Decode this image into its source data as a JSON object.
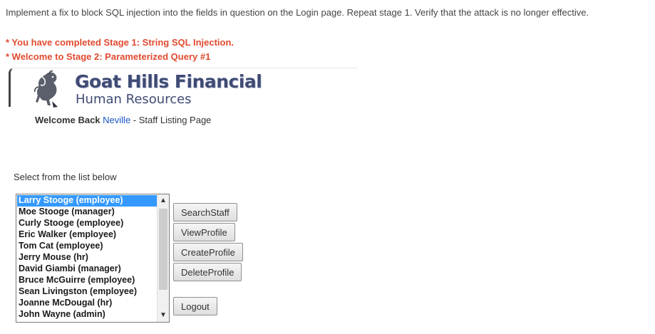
{
  "instructions": "Implement a fix to block SQL injection into the fields in question on the Login page. Repeat stage 1. Verify that the attack is no longer effective.",
  "messages": {
    "stage1": "* You have completed Stage 1: String SQL Injection.",
    "stage2": "* Welcome to Stage 2: Parameterized Query #1"
  },
  "banner": {
    "logo_icon": "goat-icon",
    "title": "Goat Hills Financial",
    "subtitle": "Human Resources"
  },
  "welcome": {
    "prefix": "Welcome Back",
    "user": "Neville",
    "suffix": "- Staff Listing Page"
  },
  "select_label": "Select from the list below",
  "staff_list": {
    "selected_index": 0,
    "items": [
      "Larry Stooge (employee)",
      "Moe Stooge (manager)",
      "Curly Stooge (employee)",
      "Eric Walker (employee)",
      "Tom Cat (employee)",
      "Jerry Mouse (hr)",
      "David Giambi (manager)",
      "Bruce McGuirre (employee)",
      "Sean Livingston (employee)",
      "Joanne McDougal (hr)",
      "John Wayne (admin)"
    ]
  },
  "buttons": {
    "search": "SearchStaff",
    "view": "ViewProfile",
    "create": "CreateProfile",
    "delete": "DeleteProfile",
    "logout": "Logout"
  },
  "colors": {
    "message": "#e04a2f",
    "brand": "#3f4b74",
    "link": "#1a56c8",
    "selection": "#3399ff"
  }
}
